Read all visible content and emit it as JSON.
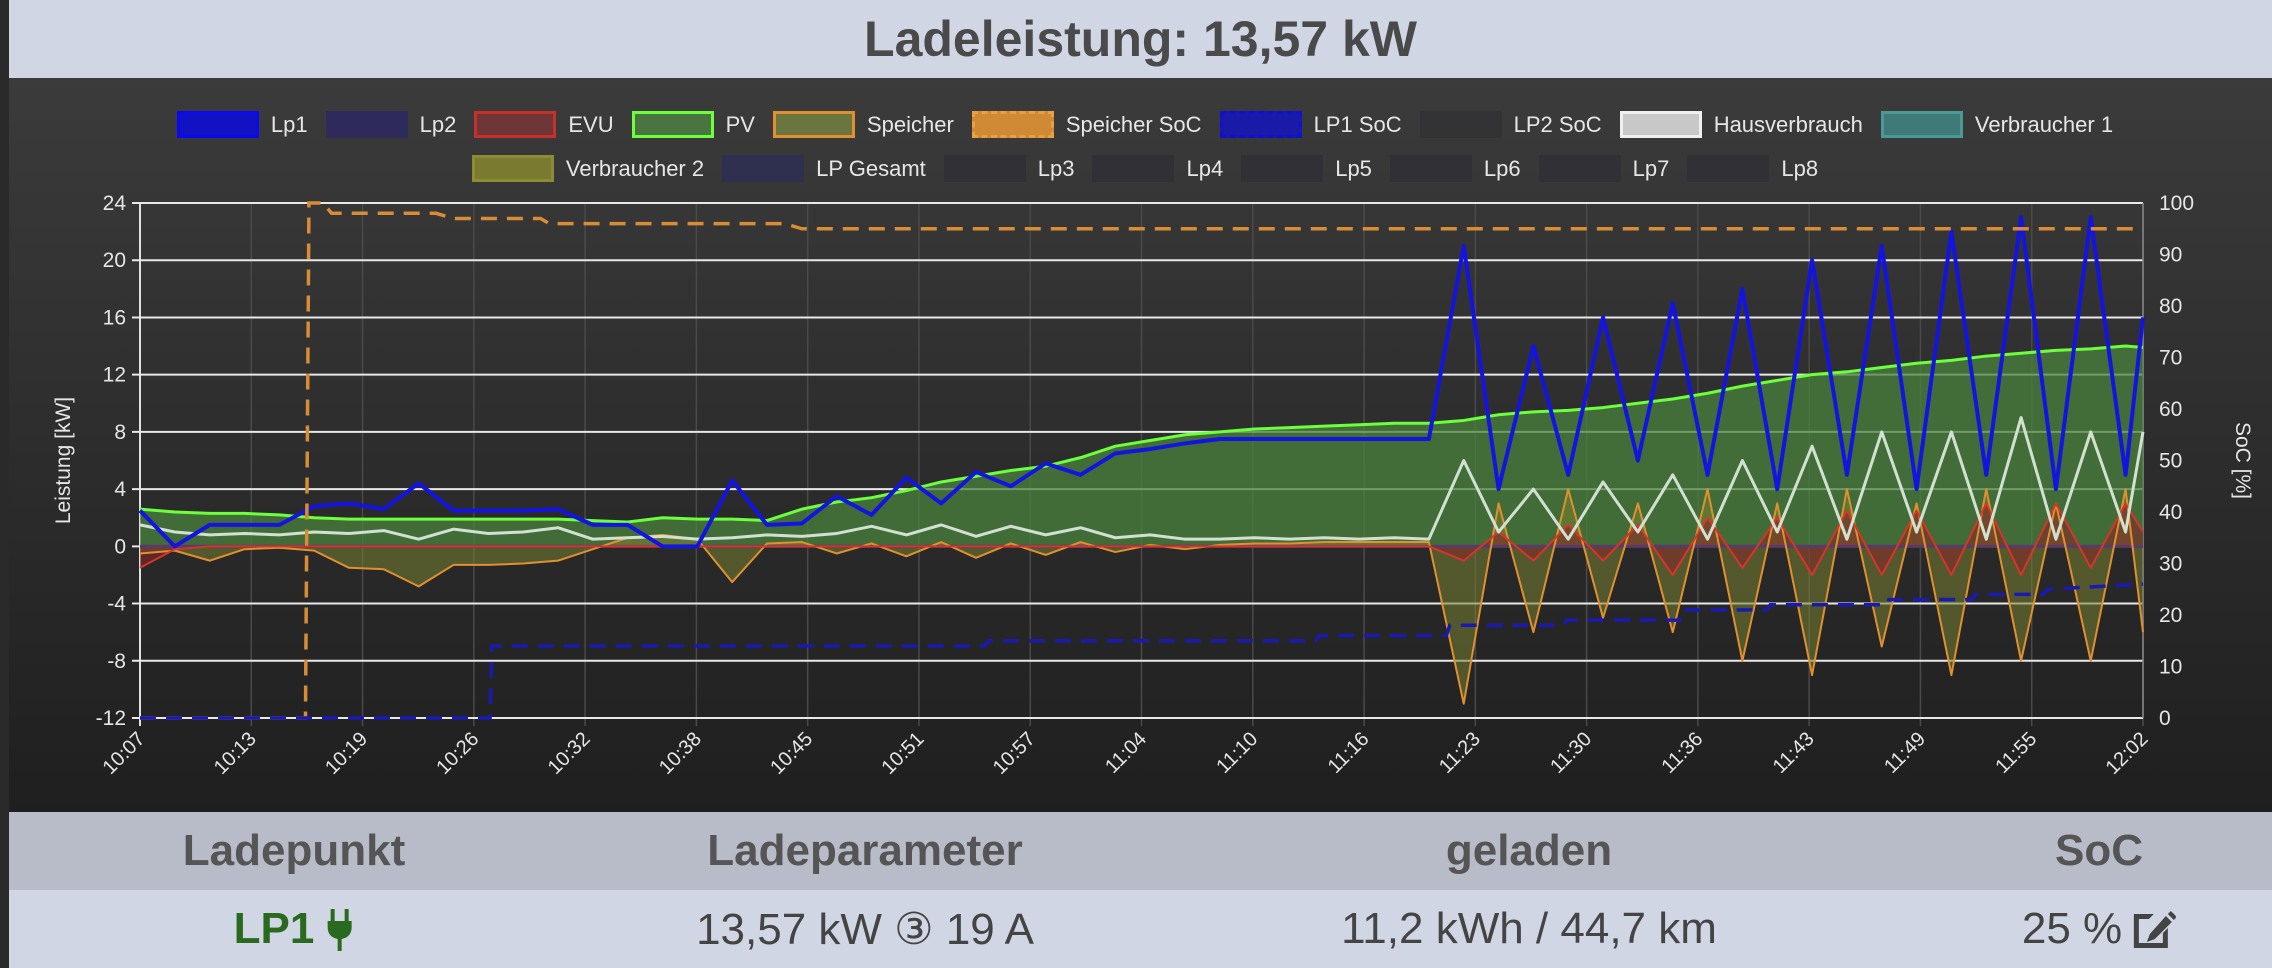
{
  "header": {
    "title": "Ladeleistung: 13,57 kW"
  },
  "legend": [
    {
      "label": "Lp1",
      "fill": "#1212c4",
      "border": "#0a0af0",
      "dashed": false
    },
    {
      "label": "Lp2",
      "fill": "#2f2a5c",
      "border": "#2f2a5c",
      "dashed": false
    },
    {
      "label": "EVU",
      "fill": "#6e3636",
      "border": "#c8302a",
      "dashed": false
    },
    {
      "label": "PV",
      "fill": "#4a7540",
      "border": "#6cff3c",
      "dashed": false
    },
    {
      "label": "Speicher",
      "fill": "#6a7540",
      "border": "#e0902e",
      "dashed": false
    },
    {
      "label": "Speicher SoC",
      "fill": "#d08a35",
      "border": "#e8a040",
      "dashed": true
    },
    {
      "label": "LP1 SoC",
      "fill": "#1a1aa8",
      "border": "#1010d0",
      "dashed": true
    },
    {
      "label": "LP2 SoC",
      "fill": "#333336",
      "border": "#333336",
      "dashed": true
    },
    {
      "label": "Hausverbrauch",
      "fill": "#c8c8c8",
      "border": "#f0f0f0",
      "dashed": false
    },
    {
      "label": "Verbraucher 1",
      "fill": "#3f7a78",
      "border": "#4a9a98",
      "dashed": false
    },
    {
      "label": "Verbraucher 2",
      "fill": "#7a7a30",
      "border": "#8c8c34",
      "dashed": false
    },
    {
      "label": "LP Gesamt",
      "fill": "#2f2f50",
      "border": "#2f2f50",
      "dashed": false
    },
    {
      "label": "Lp3",
      "fill": "#303036",
      "border": "#303036",
      "dashed": false
    },
    {
      "label": "Lp4",
      "fill": "#303036",
      "border": "#303036",
      "dashed": false
    },
    {
      "label": "Lp5",
      "fill": "#303036",
      "border": "#303036",
      "dashed": false
    },
    {
      "label": "Lp6",
      "fill": "#303036",
      "border": "#303036",
      "dashed": false
    },
    {
      "label": "Lp7",
      "fill": "#303036",
      "border": "#303036",
      "dashed": false
    },
    {
      "label": "Lp8",
      "fill": "#303036",
      "border": "#303036",
      "dashed": false
    }
  ],
  "chart_data": {
    "type": "line",
    "ylabel": "Leistung [kW]",
    "y2label": "SoC [%]",
    "ylim": [
      -12,
      24
    ],
    "yticks": [
      "24",
      "20",
      "16",
      "12",
      "8",
      "4",
      "0",
      "-4",
      "-8",
      "-12"
    ],
    "y2lim": [
      0,
      100
    ],
    "y2ticks": [
      "100",
      "90",
      "80",
      "70",
      "60",
      "50",
      "40",
      "30",
      "20",
      "10",
      "0"
    ],
    "xlabel_unit": "minutes since 10:07",
    "xlim": [
      0,
      115
    ],
    "xticks": [
      "10:07",
      "10:13",
      "10:19",
      "10:26",
      "10:32",
      "10:38",
      "10:45",
      "10:51",
      "10:57",
      "11:04",
      "11:10",
      "11:16",
      "11:23",
      "11:30",
      "11:36",
      "11:43",
      "11:49",
      "11:55",
      "12:02"
    ],
    "grid": true,
    "legend_position": "top",
    "x": [
      0,
      2,
      4,
      6,
      8,
      10,
      12,
      14,
      16,
      18,
      20,
      22,
      24,
      26,
      28,
      30,
      32,
      34,
      36,
      38,
      40,
      42,
      44,
      46,
      48,
      50,
      52,
      54,
      56,
      58,
      60,
      62,
      64,
      66,
      68,
      70,
      72,
      74,
      76,
      78,
      80,
      82,
      84,
      86,
      88,
      90,
      92,
      94,
      96,
      98,
      100,
      102,
      104,
      106,
      108,
      110,
      112,
      114,
      115
    ],
    "series": [
      {
        "name": "PV",
        "axis": "left",
        "color": "#6cff3c",
        "fill": "rgba(74,130,60,0.75)",
        "width": 3,
        "values": [
          2.6,
          2.4,
          2.3,
          2.3,
          2.2,
          2.0,
          1.9,
          1.9,
          1.9,
          1.9,
          1.9,
          1.9,
          1.9,
          1.8,
          1.7,
          2.0,
          1.9,
          1.9,
          1.8,
          2.6,
          3.1,
          3.4,
          3.9,
          4.5,
          4.9,
          5.3,
          5.6,
          6.2,
          7.0,
          7.4,
          7.8,
          8.0,
          8.2,
          8.3,
          8.4,
          8.5,
          8.6,
          8.6,
          8.8,
          9.2,
          9.4,
          9.5,
          9.7,
          10.0,
          10.3,
          10.7,
          11.2,
          11.6,
          12.0,
          12.2,
          12.5,
          12.8,
          13.0,
          13.3,
          13.5,
          13.7,
          13.8,
          14.0,
          13.9
        ]
      },
      {
        "name": "Speicher",
        "axis": "left",
        "color": "#e0902e",
        "fill": "rgba(120,130,50,0.55)",
        "width": 2,
        "values": [
          -0.5,
          -0.3,
          -1.0,
          -0.2,
          -0.1,
          -0.3,
          -1.5,
          -1.6,
          -2.8,
          -1.3,
          -1.3,
          -1.2,
          -1.0,
          -0.2,
          0.6,
          0.8,
          0.5,
          -2.5,
          0.2,
          0.3,
          -0.5,
          0.2,
          -0.7,
          0.3,
          -0.8,
          0.2,
          -0.6,
          0.3,
          -0.4,
          0.1,
          -0.2,
          0.1,
          0.2,
          0.2,
          0.3,
          0.3,
          0.3,
          0.3,
          -11,
          3,
          -6,
          4,
          -5,
          3,
          -6,
          4,
          -8,
          3,
          -9,
          4,
          -7,
          3,
          -9,
          4,
          -8,
          3,
          -8,
          4,
          -6
        ]
      },
      {
        "name": "EVU",
        "axis": "left",
        "color": "#d8342a",
        "fill": "rgba(130,40,40,0.6)",
        "width": 2,
        "values": [
          -1.5,
          -0.2,
          0,
          0,
          0,
          0,
          0,
          0,
          0,
          0,
          0,
          0,
          0,
          0,
          0,
          0,
          0,
          0,
          0,
          0,
          0,
          0,
          0,
          0,
          0,
          0,
          0,
          0,
          0,
          0,
          0,
          0,
          0,
          0,
          0,
          0,
          0,
          0,
          -1,
          1,
          -1,
          1.5,
          -1,
          1.5,
          -2,
          2,
          -1.5,
          2,
          -2,
          2.5,
          -2,
          2.5,
          -2,
          3,
          -2,
          3,
          -1.5,
          3,
          1
        ]
      },
      {
        "name": "Hausverbrauch",
        "axis": "left",
        "color": "#d2e0d2",
        "fill": null,
        "width": 3,
        "values": [
          1.5,
          1.0,
          0.8,
          0.9,
          0.8,
          1.0,
          0.9,
          1.1,
          0.5,
          1.2,
          0.9,
          1.0,
          1.3,
          0.5,
          0.6,
          0.7,
          0.5,
          0.6,
          0.8,
          0.7,
          0.9,
          1.4,
          0.8,
          1.5,
          0.7,
          1.4,
          0.8,
          1.3,
          0.6,
          0.8,
          0.5,
          0.5,
          0.6,
          0.5,
          0.6,
          0.5,
          0.6,
          0.5,
          6,
          1,
          4,
          0.5,
          4.5,
          1,
          5,
          0.5,
          6,
          1,
          7,
          0.5,
          8,
          1,
          8,
          0.5,
          9,
          0.5,
          8,
          1,
          8
        ]
      },
      {
        "name": "Lp1",
        "axis": "left",
        "color": "#1414e0",
        "fill": null,
        "width": 4,
        "values": [
          2.5,
          0,
          1.5,
          1.5,
          1.5,
          2.8,
          3.0,
          2.6,
          4.4,
          2.5,
          2.5,
          2.5,
          2.6,
          1.5,
          1.5,
          0,
          0,
          4.6,
          1.5,
          1.6,
          3.5,
          2.2,
          4.8,
          3.0,
          5.2,
          4.2,
          5.8,
          5.0,
          6.5,
          6.8,
          7.2,
          7.5,
          7.5,
          7.5,
          7.5,
          7.5,
          7.5,
          7.5,
          21,
          4,
          14,
          5,
          16,
          6,
          17,
          5,
          18,
          4,
          20,
          5,
          21,
          4,
          22,
          5,
          23,
          4,
          23,
          5,
          16
        ]
      }
    ],
    "soc_series": [
      {
        "name": "Speicher SoC",
        "color": "#d88c35",
        "points": [
          [
            0,
            0
          ],
          [
            9.5,
            0
          ],
          [
            9.7,
            100
          ],
          [
            10.5,
            100
          ],
          [
            11,
            98
          ],
          [
            17,
            98
          ],
          [
            18,
            97
          ],
          [
            23,
            97
          ],
          [
            23.5,
            96
          ],
          [
            37,
            96
          ],
          [
            38,
            95
          ],
          [
            115,
            95
          ]
        ]
      },
      {
        "name": "LP1 SoC",
        "color": "#1a1ab0",
        "points": [
          [
            0,
            0
          ],
          [
            20.1,
            0
          ],
          [
            20.2,
            14
          ],
          [
            48.5,
            14
          ],
          [
            48.7,
            15
          ],
          [
            67.5,
            15
          ],
          [
            67.7,
            16
          ],
          [
            75,
            16
          ],
          [
            75.2,
            18
          ],
          [
            81.7,
            18
          ],
          [
            81.9,
            19
          ],
          [
            88.4,
            19
          ],
          [
            88.6,
            21
          ],
          [
            93.4,
            21
          ],
          [
            93.6,
            22
          ],
          [
            100.1,
            22
          ],
          [
            100.3,
            23
          ],
          [
            105.2,
            23
          ],
          [
            105.4,
            24
          ],
          [
            109.3,
            24
          ],
          [
            109.5,
            25
          ],
          [
            115,
            26
          ]
        ]
      }
    ]
  },
  "table": {
    "headers": [
      "Ladepunkt",
      "Ladeparameter",
      "geladen",
      "SoC"
    ],
    "row": {
      "ladepunkt": "LP1",
      "ladeparameter": "13,57 kW ③ 19 A",
      "geladen": "11,2 kWh / 44,7 km",
      "soc": "25 %"
    }
  }
}
